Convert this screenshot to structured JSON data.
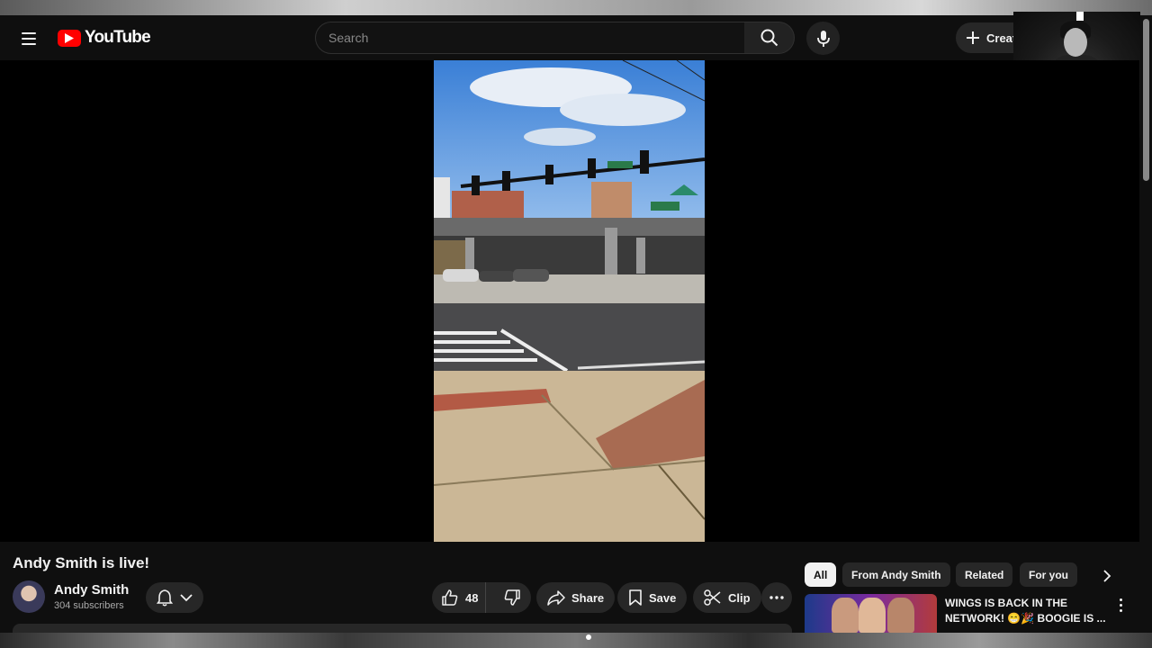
{
  "header": {
    "logo_text": "YouTube",
    "search_placeholder": "Search",
    "create_label": "Create"
  },
  "video": {
    "title": "Andy Smith is live!",
    "channel_name": "Andy Smith",
    "subscribers": "304 subscribers",
    "likes": "48",
    "actions": {
      "share": "Share",
      "save": "Save",
      "clip": "Clip"
    }
  },
  "sidebar": {
    "chips": [
      {
        "label": "All",
        "active": true
      },
      {
        "label": "From Andy Smith",
        "active": false
      },
      {
        "label": "Related",
        "active": false
      },
      {
        "label": "For you",
        "active": false
      }
    ],
    "recommendation": {
      "title": "WINGS IS BACK IN THE NETWORK! 😁🎉 BOOGIE IS ..."
    }
  },
  "colors": {
    "background": "#0f0f0f",
    "brand_red": "#ff0000",
    "chip_bg": "#272727",
    "text": "#f1f1f1"
  }
}
